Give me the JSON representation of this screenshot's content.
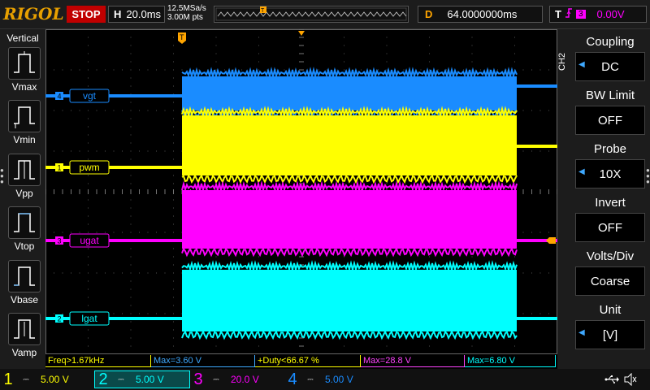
{
  "topbar": {
    "logo": "RIGOL",
    "run_state": "STOP",
    "horizontal_label": "H",
    "timebase": "20.0ms",
    "sample_rate": "12.5MSa/s",
    "memory_depth": "3.00M pts",
    "delay_label": "D",
    "delay_value": "64.0000000ms",
    "trigger_label": "T",
    "trigger_source": "3",
    "trigger_level": "0.00V"
  },
  "left_panel": {
    "title": "Vertical",
    "items": [
      {
        "label": "Vmax",
        "icon": "vmax-icon"
      },
      {
        "label": "Vmin",
        "icon": "vmin-icon"
      },
      {
        "label": "Vpp",
        "icon": "vpp-icon"
      },
      {
        "label": "Vtop",
        "icon": "vtop-icon"
      },
      {
        "label": "Vbase",
        "icon": "vbase-icon"
      },
      {
        "label": "Vamp",
        "icon": "vamp-icon"
      }
    ]
  },
  "waveforms": [
    {
      "channel": "4",
      "name": "vgt",
      "color": "#1a8cff"
    },
    {
      "channel": "1",
      "name": "pwm",
      "color": "#ffff00"
    },
    {
      "channel": "3",
      "name": "ugat",
      "color": "#ff00ff"
    },
    {
      "channel": "2",
      "name": "lgat",
      "color": "#00ffff"
    }
  ],
  "trigger_marker": "T",
  "measurements": [
    {
      "text": "Freq>1.67kHz",
      "color": "#ffff00"
    },
    {
      "text": "Max=3.60 V",
      "color": "#3fa9ff"
    },
    {
      "text": "+Duty<66.67 %",
      "color": "#ffff00"
    },
    {
      "text": "Max=28.8 V",
      "color": "#ff44ff"
    },
    {
      "text": "Max=6.80 V",
      "color": "#00ffff"
    }
  ],
  "right_panel": {
    "channel_tag": "CH2",
    "menus": [
      {
        "title": "Coupling",
        "value": "DC"
      },
      {
        "title": "BW Limit",
        "value": "OFF"
      },
      {
        "title": "Probe",
        "value": "10X"
      },
      {
        "title": "Invert",
        "value": "OFF"
      },
      {
        "title": "Volts/Div",
        "value": "Coarse"
      },
      {
        "title": "Unit",
        "value": "[V]"
      }
    ]
  },
  "channels": [
    {
      "num": "1",
      "scale": "5.00 V",
      "color": "#ffff00",
      "active": false
    },
    {
      "num": "2",
      "scale": "5.00 V",
      "color": "#00ffff",
      "active": true
    },
    {
      "num": "3",
      "scale": "20.0 V",
      "color": "#ff00ff",
      "active": false
    },
    {
      "num": "4",
      "scale": "5.00 V",
      "color": "#1a8cff",
      "active": false
    }
  ],
  "colors": {
    "accent_orange": "#ffa500",
    "stop_red": "#c00000"
  }
}
